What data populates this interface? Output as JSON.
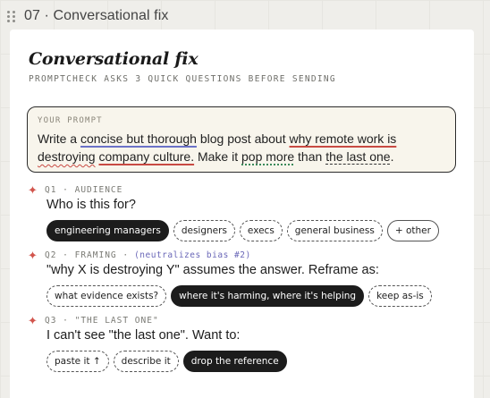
{
  "frame": {
    "title": "07 · Conversational fix"
  },
  "card": {
    "title": "Conversational fix",
    "subtitle": "PROMPTCHECK ASKS 3 QUICK QUESTIONS BEFORE SENDING"
  },
  "prompt": {
    "label": "YOUR PROMPT",
    "segments": {
      "s1": "Write a ",
      "s2": "concise but thorough",
      "s3": " blog post about ",
      "s4": "why remote work is",
      "s5": "destroying",
      "s6": " ",
      "s7": "company culture.",
      "s8": " Make it ",
      "s9": "pop more",
      "s10": " than ",
      "s11": "the last one",
      "s12": "."
    }
  },
  "questions": [
    {
      "meta": "Q1 · AUDIENCE",
      "note": "",
      "text": "Who is this for?",
      "options": [
        "engineering managers",
        "designers",
        "execs",
        "general business",
        "+ other"
      ]
    },
    {
      "meta": "Q2 · FRAMING ·",
      "note": "(neutralizes bias #2)",
      "text": "\"why X is destroying Y\" assumes the answer. Reframe as:",
      "options": [
        "what evidence exists?",
        "where it's harming, where it's helping",
        "keep as-is"
      ]
    },
    {
      "meta": "Q3 · \"THE LAST ONE\"",
      "note": "",
      "text": "I can't see \"the last one\". Want to:",
      "options": [
        "paste it ↑",
        "describe it",
        "drop the reference"
      ]
    }
  ],
  "colors": {
    "accent_red": "#c84a43",
    "accent_blue": "#6b72c8",
    "accent_green": "#3b8a5a",
    "selected_chip": "#1c1c1c"
  },
  "icons": {
    "drag_handle": "grip-dots-icon",
    "question_marker": "sparkle-icon"
  }
}
